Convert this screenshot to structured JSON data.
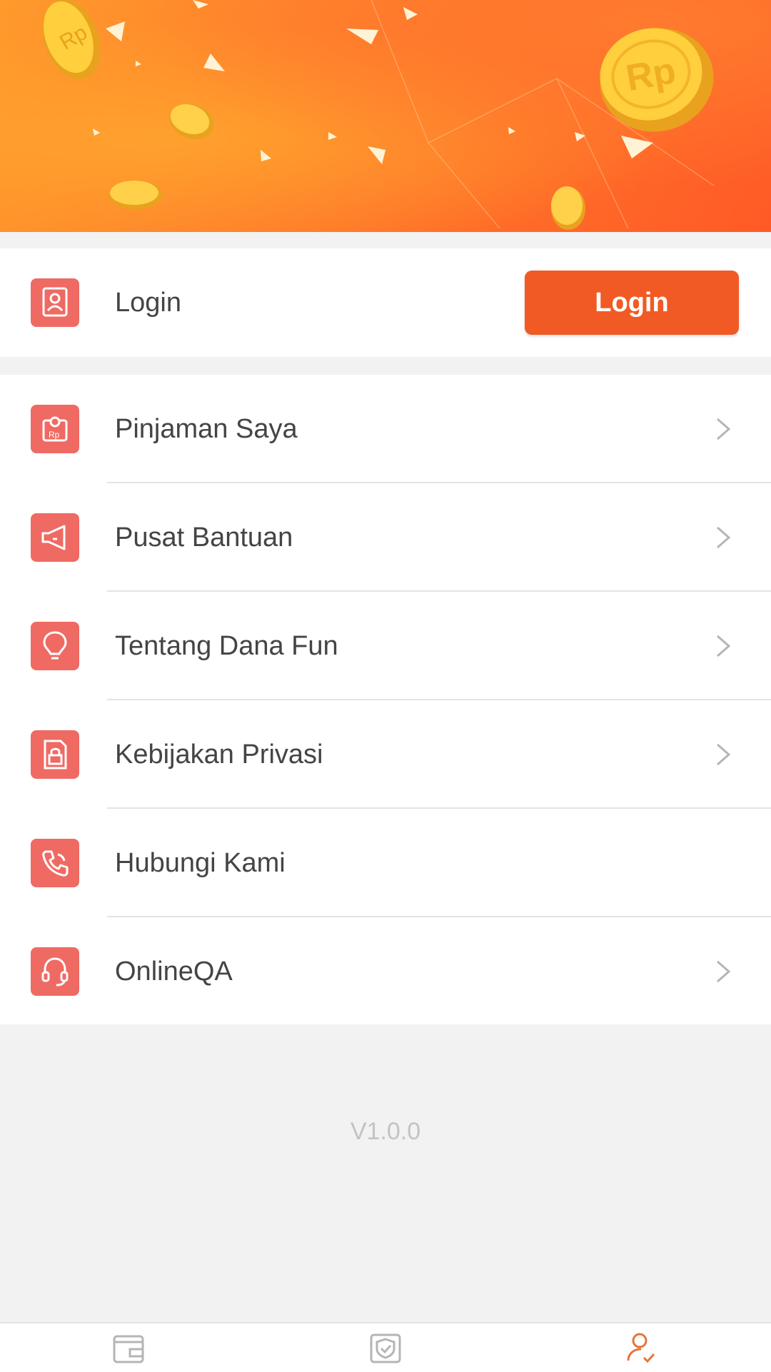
{
  "banner": {
    "coin_text": "Rp"
  },
  "login_row": {
    "label": "Login",
    "button_label": "Login",
    "icon": "profile-card-icon"
  },
  "menu": [
    {
      "label": "Pinjaman Saya",
      "icon": "loan-document-icon",
      "has_chevron": true
    },
    {
      "label": "Pusat Bantuan",
      "icon": "megaphone-icon",
      "has_chevron": true
    },
    {
      "label": "Tentang Dana Fun",
      "icon": "lightbulb-icon",
      "has_chevron": true
    },
    {
      "label": "Kebijakan Privasi",
      "icon": "privacy-lock-icon",
      "has_chevron": true
    },
    {
      "label": "Hubungi Kami",
      "icon": "phone-icon",
      "has_chevron": false
    },
    {
      "label": "OnlineQA",
      "icon": "headset-icon",
      "has_chevron": true
    }
  ],
  "version": "V1.0.0",
  "tabbar": [
    {
      "icon": "wallet-tab-icon",
      "active": false
    },
    {
      "icon": "shield-tab-icon",
      "active": false
    },
    {
      "icon": "user-tab-icon",
      "active": true
    }
  ],
  "colors": {
    "accent": "#f15a24",
    "icon_bg": "#ef6a63",
    "background": "#f2f2f2",
    "tab_active": "#e8743b",
    "tab_inactive": "#b5b5b5"
  }
}
